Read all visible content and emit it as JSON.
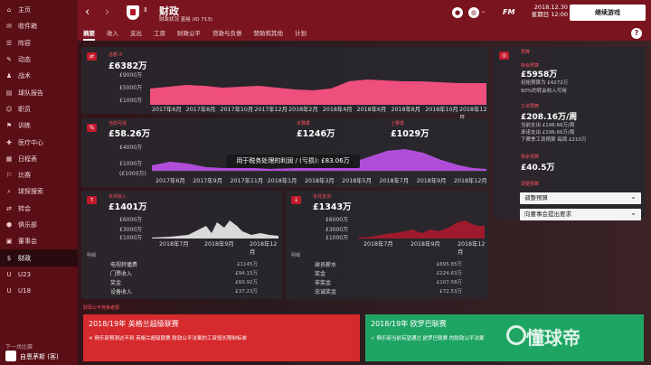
{
  "sidebar": {
    "items": [
      {
        "icon": "home-icon",
        "label": "主页"
      },
      {
        "icon": "inbox-icon",
        "label": "收件箱"
      },
      {
        "icon": "squad-icon",
        "label": "阵容"
      },
      {
        "icon": "news-icon",
        "label": "动态"
      },
      {
        "icon": "tactics-icon",
        "label": "战术"
      },
      {
        "icon": "report-icon",
        "label": "球队报告"
      },
      {
        "icon": "staff-icon",
        "label": "职员"
      },
      {
        "icon": "training-icon",
        "label": "训练"
      },
      {
        "icon": "medical-icon",
        "label": "医疗中心"
      },
      {
        "icon": "schedule-icon",
        "label": "日程表"
      },
      {
        "icon": "competitions-icon",
        "label": "比赛"
      },
      {
        "icon": "scouting-icon",
        "label": "球探搜索"
      },
      {
        "icon": "transfers-icon",
        "label": "转会"
      },
      {
        "icon": "club-icon",
        "label": "俱乐部"
      },
      {
        "icon": "board-icon",
        "label": "董事会"
      },
      {
        "icon": "finances-icon",
        "label": "财政"
      },
      {
        "icon": "u23-icon",
        "label": "U23"
      },
      {
        "icon": "u18-icon",
        "label": "U18"
      }
    ],
    "active_index": 15,
    "footer_hint": "下一场比赛",
    "footer_match": "自恩茅斯 (客)"
  },
  "topbar": {
    "title": "财政",
    "subtitle": "财政状况 富裕 (ID 713)",
    "date": "2018.12.30",
    "time": "星期日 12:00",
    "fm_label": "FM",
    "continue_label": "继续游戏"
  },
  "tabs": [
    "摘要",
    "收入",
    "支出",
    "工资",
    "财政公平",
    "贷款与负债",
    "赞助和其他",
    "计划"
  ],
  "active_tab": 0,
  "balance": {
    "title": "总额 ⏱",
    "value": "£6382万",
    "ylabels": [
      "£9000万",
      "£5000万",
      "£1000万"
    ],
    "xlabels": [
      "2017年6月",
      "2017年8月",
      "2017年10月",
      "2017年12月",
      "2018年2月",
      "2018年4月",
      "2018年6月",
      "2018年8月",
      "2018年10月",
      "2018年12月"
    ]
  },
  "profit": {
    "a_title": "当前亏损",
    "a_value": "£58.26万",
    "b_title": "本赛季",
    "b_value": "£1246万",
    "c_title": "上赛季",
    "c_value": "£1029万",
    "ylabels": [
      "£4000万",
      "£1000万",
      "(£1000万)"
    ],
    "xlabels": [
      "2017年6月",
      "2017年9月",
      "2017年11月",
      "2018年1月",
      "2018年3月",
      "2018年5月",
      "2018年7月",
      "2018年9月",
      "2018年12月"
    ],
    "tooltip": "用于税务处理的利润 / (亏损): £83.06万"
  },
  "income": {
    "title": "本月收入",
    "value": "£1401万",
    "ylabels": [
      "£6000万",
      "£3000万",
      "£1000万"
    ],
    "xlabels": [
      "2018年7月",
      "2018年9月",
      "2018年12月"
    ],
    "detail_header": "明细",
    "details": [
      {
        "label": "电视转播费",
        "value": "£1145万"
      },
      {
        "label": "门票收入",
        "value": "£94.13万"
      },
      {
        "label": "奖金",
        "value": "£60.92万"
      },
      {
        "label": "设备收入",
        "value": "£37.23万"
      }
    ]
  },
  "expense": {
    "title": "本月支出",
    "value": "£1343万",
    "ylabels": [
      "£6000万",
      "£3000万",
      "£1000万"
    ],
    "xlabels": [
      "2018年7月",
      "2018年9月",
      "2018年12月"
    ],
    "detail_header": "明细",
    "details": [
      {
        "label": "球员薪水",
        "value": "£695.85万"
      },
      {
        "label": "奖金",
        "value": "£224.63万"
      },
      {
        "label": "非奖金",
        "value": "£107.58万"
      },
      {
        "label": "忠诚奖金",
        "value": "£72.53万"
      }
    ]
  },
  "right": {
    "header": "预算",
    "transfer_label": "转会预算",
    "transfer_value": "£5958万",
    "transfer_note1": "初始预算为 £4272万",
    "transfer_note2": "90%的转会收入可用",
    "wage_label": "工资预算",
    "wage_value": "£208.16万/周",
    "wage_note1": "当前支出 £196.66万/周",
    "wage_note2": "承诺支出 £196.66万/周",
    "wage_note3": "下赛季工资预算 每周 £210万",
    "remain_label": "剩余预算",
    "remain_value": "£40.5万",
    "adjust_label": "调整预算",
    "select1": "调整预算",
    "select2": "向董事会提出要求"
  },
  "bottom": {
    "label": "财政公平竞争者报",
    "left_title": "2018/19年 英格兰超级联赛",
    "left_text": "✕ 俱乐部预测达不到 英格兰超级联赛 财政公平法案的工资增长限制标准",
    "right_title": "2018/19年 欧罗巴联赛",
    "right_text": "✓ 俱乐部当前有望通过 欧罗巴联赛 的财政公平法案"
  },
  "watermark": "懂球帝"
}
